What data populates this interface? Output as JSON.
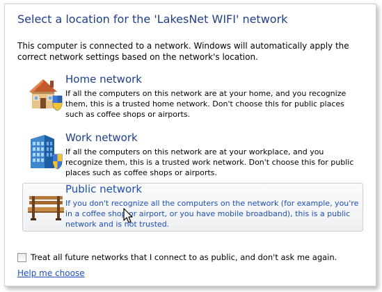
{
  "dialog": {
    "title": "Select a location for the 'LakesNet WIFI' network",
    "intro": "This computer is connected to a network. Windows will automatically apply the correct network settings based on the network's location."
  },
  "options": [
    {
      "name": "Home network",
      "description": "If all the computers on this network are at your home, and you recognize them, this is a trusted home network.  Don't choose this for public places such as coffee shops or airports.",
      "icon": "house-shield-icon",
      "hovered": false
    },
    {
      "name": "Work network",
      "description": "If all the computers on this network are at your workplace, and you recognize them, this is a trusted work network.  Don't choose this for public places such as coffee shops or airports.",
      "icon": "office-building-shield-icon",
      "hovered": false
    },
    {
      "name": "Public network",
      "description": "If you don't recognize all the computers on the network (for example, you're in a coffee shop or airport, or you have mobile broadband), this is a public network and is not trusted.",
      "icon": "park-bench-icon",
      "hovered": true
    }
  ],
  "checkbox": {
    "label": "Treat all future networks that I connect to as public, and don't ask me again.",
    "checked": false
  },
  "help_link": "Help me choose",
  "colors": {
    "title": "#1e3f8a",
    "link": "#1a4fc4",
    "hover_text": "#1c4fb8"
  }
}
